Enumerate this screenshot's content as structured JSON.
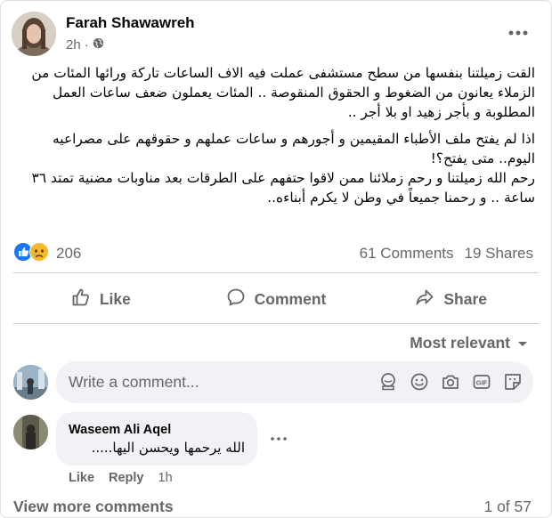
{
  "post": {
    "author": "Farah Shawawreh",
    "time": "2h",
    "privacy_icon": "globe-icon",
    "paragraphs": [
      "القت زميلتنا بنفسها من سطح مستشفى عملت فيه الاف الساعات تاركة ورائها المئات من الزملاء يعانون من الضغوط و الحقوق المنقوصة .. المئات يعملون ضعف ساعات العمل المطلوبة و بأجر زهيد او بلا أجر ..",
      "اذا لم يفتح ملف الأطباء المقيمين و أجورهم و ساعات عملهم و حقوقهم على مصراعيه اليوم.. متى يفتح؟!\nرحم الله زميلتنا و رحم زملائنا ممن لاقوا حتفهم على الطرقات بعد مناوبات مضنية تمتد ٣٦ ساعة .. و رحمنا جميعاً في وطن لا يكرم أبناءه.."
    ]
  },
  "stats": {
    "reaction_count": "206",
    "reaction_icons": [
      "like-icon",
      "sad-icon"
    ],
    "comments": "61 Comments",
    "shares": "19 Shares"
  },
  "actions": {
    "like": "Like",
    "comment": "Comment",
    "share": "Share"
  },
  "sort": {
    "label": "Most relevant"
  },
  "composer": {
    "placeholder": "Write a comment...",
    "icons": [
      "avatar-sticker-icon",
      "emoji-icon",
      "camera-icon",
      "gif-icon",
      "sticker-icon"
    ]
  },
  "comments": [
    {
      "author": "Waseem Ali Aqel",
      "text": "الله يرحمها ويحسن اليها.....",
      "like": "Like",
      "reply": "Reply",
      "time": "1h"
    }
  ],
  "footer": {
    "view_more": "View more comments",
    "pager": "1 of 57"
  },
  "colors": {
    "like_blue": "#1877f2",
    "sad_yellow": "#f7b928",
    "secondary_text": "#65676b",
    "comment_bg": "#f0f2f5"
  }
}
